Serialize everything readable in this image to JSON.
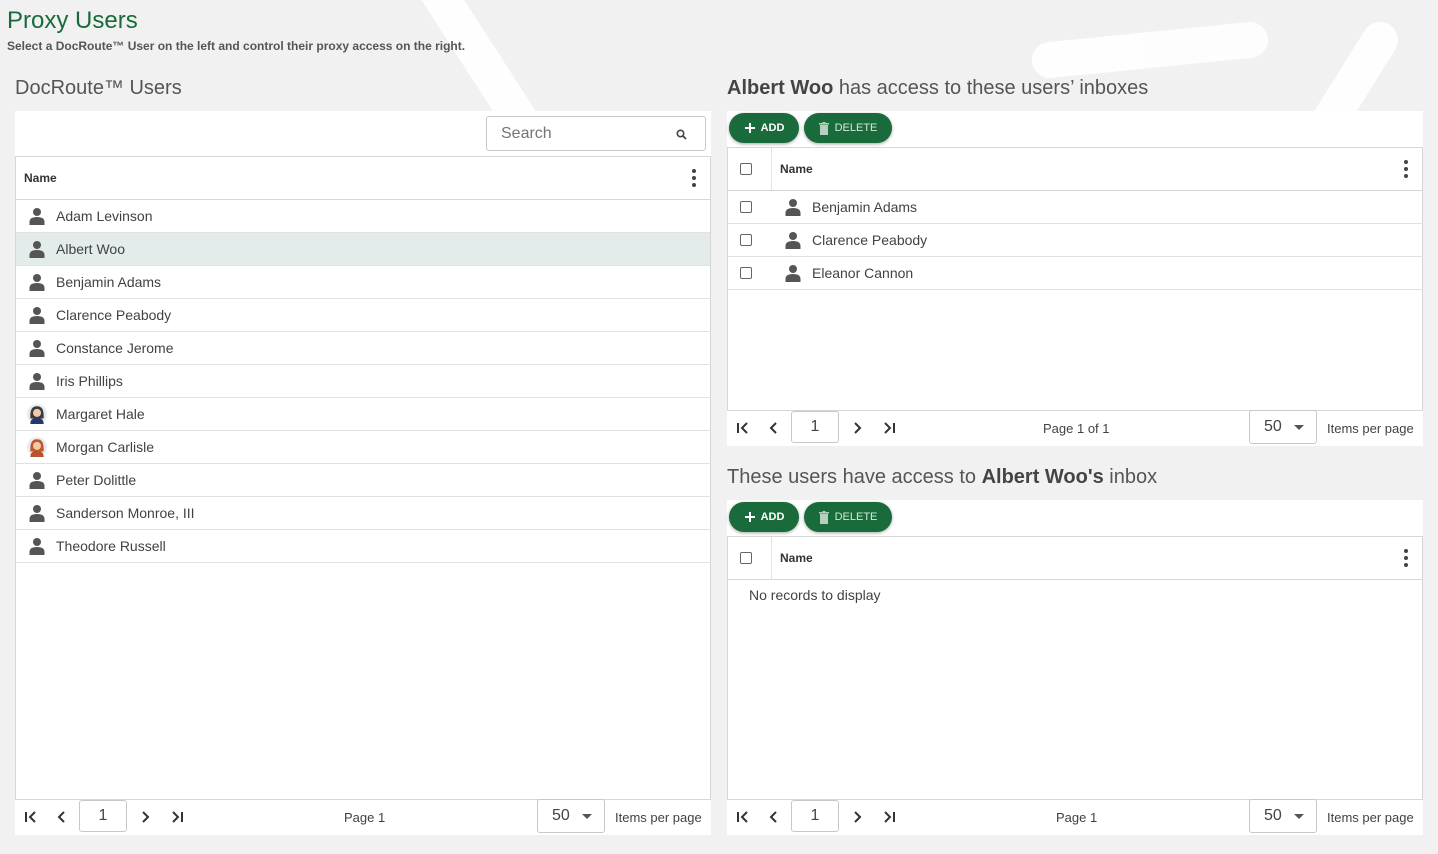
{
  "page": {
    "title": "Proxy Users",
    "subtitle": "Select a DocRoute™ User on the left and control their proxy access on the right."
  },
  "left": {
    "title": "DocRoute™ Users",
    "search_placeholder": "Search",
    "column_name": "Name",
    "users": [
      {
        "name": "Adam Levinson",
        "avatar": "person-icon"
      },
      {
        "name": "Albert Woo",
        "avatar": "person-icon",
        "selected": true
      },
      {
        "name": "Benjamin Adams",
        "avatar": "person-icon"
      },
      {
        "name": "Clarence Peabody",
        "avatar": "person-icon"
      },
      {
        "name": "Constance Jerome",
        "avatar": "person-icon"
      },
      {
        "name": "Iris Phillips",
        "avatar": "person-icon"
      },
      {
        "name": "Margaret Hale",
        "avatar": "photo-avatar"
      },
      {
        "name": "Morgan Carlisle",
        "avatar": "photo-avatar"
      },
      {
        "name": "Peter Dolittle",
        "avatar": "person-icon"
      },
      {
        "name": "Sanderson Monroe, III",
        "avatar": "person-icon"
      },
      {
        "name": "Theodore Russell",
        "avatar": "person-icon"
      }
    ],
    "pager": {
      "page_value": "1",
      "page_text": "Page 1",
      "page_size": "50",
      "items_per_page": "Items per page"
    }
  },
  "top_right": {
    "title_bold": "Albert Woo",
    "title_rest": " has access to these users’ inboxes",
    "add_label": "ADD",
    "delete_label": "DELETE",
    "column_name": "Name",
    "users": [
      "Benjamin Adams",
      "Clarence Peabody",
      "Eleanor Cannon"
    ],
    "pager": {
      "page_value": "1",
      "page_text": "Page 1 of 1",
      "page_size": "50",
      "items_per_page": "Items per page"
    }
  },
  "bottom_right": {
    "title_pre": "These users have access to ",
    "title_bold": "Albert Woo's",
    "title_post": " inbox",
    "add_label": "ADD",
    "delete_label": "DELETE",
    "column_name": "Name",
    "empty_text": "No records to display",
    "pager": {
      "page_value": "1",
      "page_text": "Page 1",
      "page_size": "50",
      "items_per_page": "Items per page"
    }
  },
  "colors": {
    "accent": "#1a6b3c",
    "selected_row": "#e3ebeb"
  }
}
